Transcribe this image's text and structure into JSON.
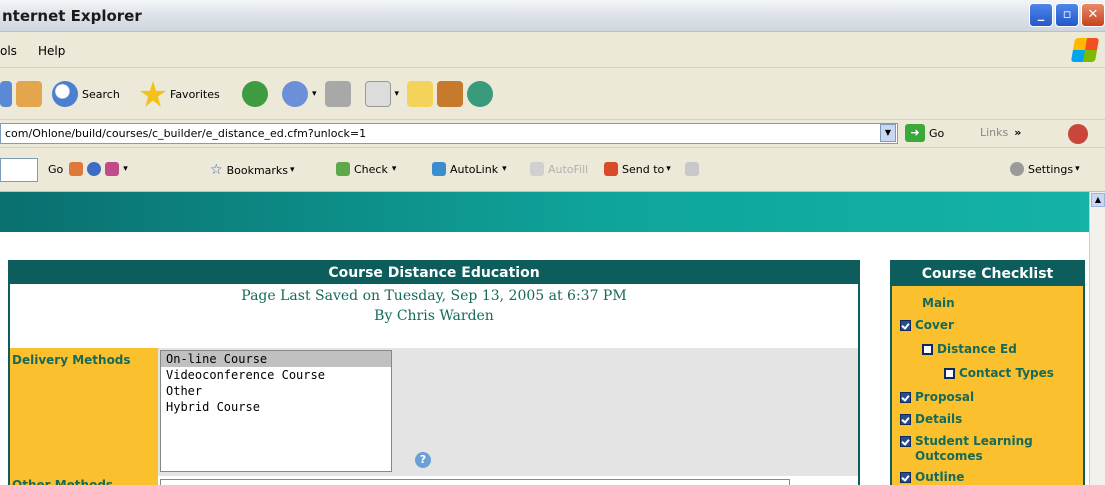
{
  "window": {
    "title": "nternet Explorer"
  },
  "menu": {
    "items": [
      "ols",
      "Help"
    ]
  },
  "toolbar": {
    "search_label": "Search",
    "favorites_label": "Favorites"
  },
  "address": {
    "url": "com/Ohlone/build/courses/c_builder/e_distance_ed.cfm?unlock=1",
    "go_label": "Go",
    "links_label": "Links",
    "links_more": "»"
  },
  "gtoolbar": {
    "go_label": "Go",
    "bookmarks_label": "Bookmarks",
    "check_label": "Check",
    "autolink_label": "AutoLink",
    "autofill_label": "AutoFill",
    "sendto_label": "Send to",
    "settings_label": "Settings"
  },
  "form": {
    "title": "Course Distance Education",
    "saved_line": "Page Last Saved on Tuesday, Sep 13, 2005 at 6:37 PM",
    "by_line": "By Chris Warden",
    "delivery_label": "Delivery Methods",
    "delivery_options": [
      "On-line Course",
      "Videoconference Course",
      "Other",
      "Hybrid Course"
    ],
    "delivery_selected_index": 0,
    "other_methods_label": "Other Methods",
    "help_glyph": "?"
  },
  "checklist": {
    "title": "Course Checklist",
    "items": {
      "main": "Main",
      "cover": "Cover",
      "distance_ed": "Distance Ed",
      "contact_types": "Contact Types",
      "proposal": "Proposal",
      "details": "Details",
      "slo": "Student Learning Outcomes",
      "outline": "Outline"
    }
  },
  "colors": {
    "teal": "#0d5d5d",
    "gold": "#fbc02d",
    "text_teal": "#166a5a"
  }
}
